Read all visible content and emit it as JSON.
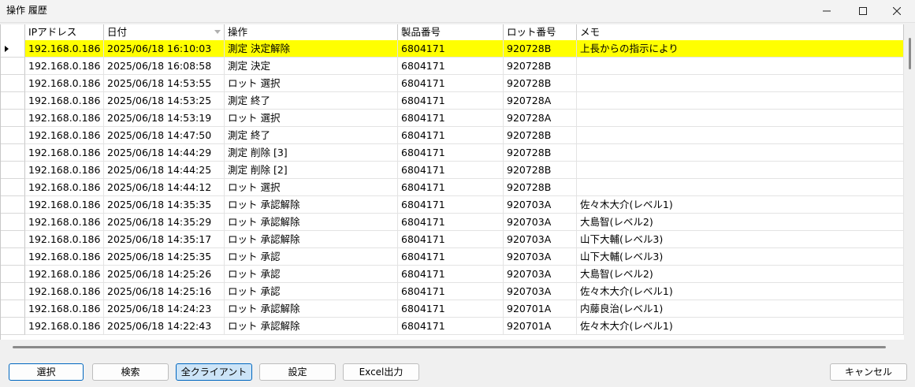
{
  "window": {
    "title": "操作 履歴",
    "controls": {
      "minimize": "—",
      "maximize": "☐",
      "close": "✕"
    }
  },
  "grid": {
    "columns": [
      "IPアドレス",
      "日付",
      "操作",
      "製品番号",
      "ロット番号",
      "メモ"
    ],
    "sorted_column": "日付",
    "selected_row": 0,
    "selected_color": "#ffff00",
    "rows": [
      [
        "192.168.0.186",
        "2025/06/18 16:10:03",
        "測定 決定解除",
        "6804171",
        "920728B",
        "上長からの指示により"
      ],
      [
        "192.168.0.186",
        "2025/06/18 16:08:58",
        "測定 決定",
        "6804171",
        "920728B",
        ""
      ],
      [
        "192.168.0.186",
        "2025/06/18 14:53:55",
        "ロット 選択",
        "6804171",
        "920728B",
        ""
      ],
      [
        "192.168.0.186",
        "2025/06/18 14:53:25",
        "測定 終了",
        "6804171",
        "920728A",
        ""
      ],
      [
        "192.168.0.186",
        "2025/06/18 14:53:19",
        "ロット 選択",
        "6804171",
        "920728A",
        ""
      ],
      [
        "192.168.0.186",
        "2025/06/18 14:47:50",
        "測定 終了",
        "6804171",
        "920728B",
        ""
      ],
      [
        "192.168.0.186",
        "2025/06/18 14:44:29",
        "測定 削除 [3]",
        "6804171",
        "920728B",
        ""
      ],
      [
        "192.168.0.186",
        "2025/06/18 14:44:25",
        "測定 削除 [2]",
        "6804171",
        "920728B",
        ""
      ],
      [
        "192.168.0.186",
        "2025/06/18 14:44:12",
        "ロット 選択",
        "6804171",
        "920728B",
        ""
      ],
      [
        "192.168.0.186",
        "2025/06/18 14:35:35",
        "ロット 承認解除",
        "6804171",
        "920703A",
        "佐々木大介(レベル1)"
      ],
      [
        "192.168.0.186",
        "2025/06/18 14:35:29",
        "ロット 承認解除",
        "6804171",
        "920703A",
        "大島智(レベル2)"
      ],
      [
        "192.168.0.186",
        "2025/06/18 14:35:17",
        "ロット 承認解除",
        "6804171",
        "920703A",
        "山下大輔(レベル3)"
      ],
      [
        "192.168.0.186",
        "2025/06/18 14:25:35",
        "ロット 承認",
        "6804171",
        "920703A",
        "山下大輔(レベル3)"
      ],
      [
        "192.168.0.186",
        "2025/06/18 14:25:26",
        "ロット 承認",
        "6804171",
        "920703A",
        "大島智(レベル2)"
      ],
      [
        "192.168.0.186",
        "2025/06/18 14:25:16",
        "ロット 承認",
        "6804171",
        "920703A",
        "佐々木大介(レベル1)"
      ],
      [
        "192.168.0.186",
        "2025/06/18 14:24:23",
        "ロット 承認解除",
        "6804171",
        "920701A",
        "内藤良治(レベル1)"
      ],
      [
        "192.168.0.186",
        "2025/06/18 14:22:43",
        "ロット 承認解除",
        "6804171",
        "920701A",
        "佐々木大介(レベル1)"
      ]
    ]
  },
  "buttons": {
    "select": "選択",
    "search": "検索",
    "all_clients": "全クライアント",
    "settings": "設定",
    "excel_export": "Excel出力",
    "cancel": "キャンセル"
  }
}
